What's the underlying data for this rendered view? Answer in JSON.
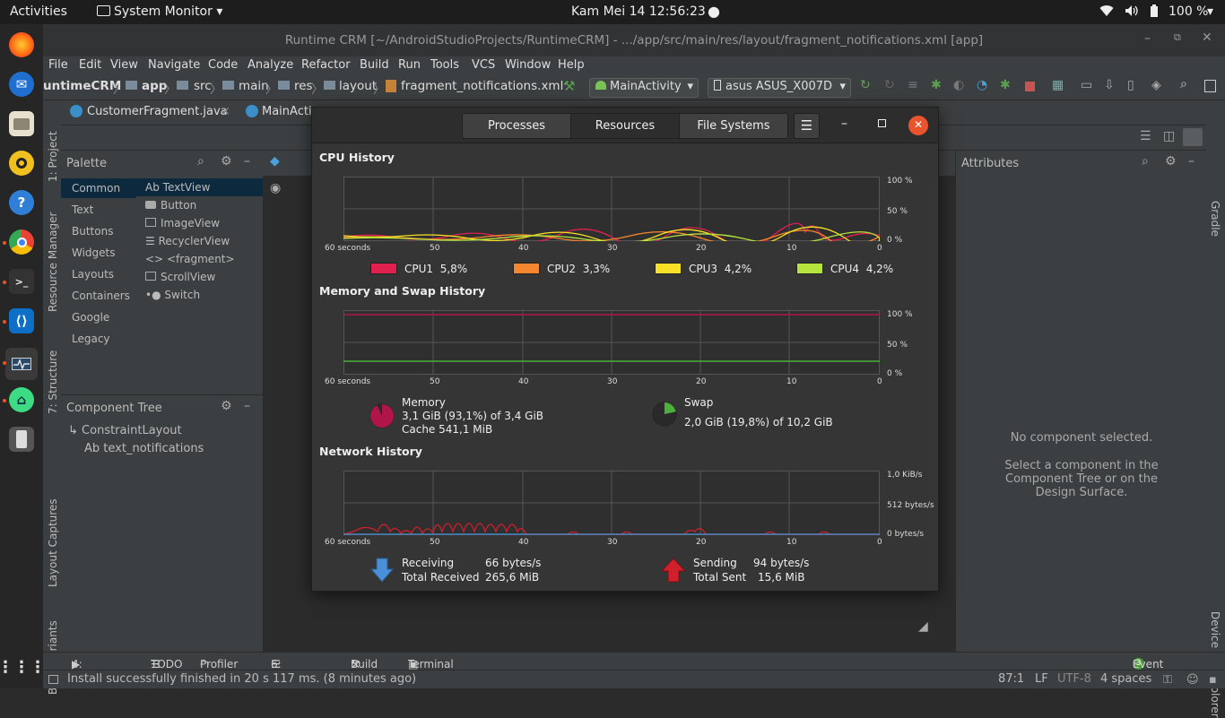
{
  "topbar": {
    "activities": "Activities",
    "app_menu": "System Monitor",
    "clock": "Kam Mei 14  12:56:23",
    "battery": "100 %"
  },
  "ide": {
    "title": "Runtime CRM [~/AndroidStudioProjects/RuntimeCRM] - .../app/src/main/res/layout/fragment_notifications.xml [app]",
    "menu": [
      "File",
      "Edit",
      "View",
      "Navigate",
      "Code",
      "Analyze",
      "Refactor",
      "Build",
      "Run",
      "Tools",
      "VCS",
      "Window",
      "Help"
    ],
    "breadcrumb": [
      "untimeCRM",
      "app",
      "src",
      "main",
      "res",
      "layout",
      "fragment_notifications.xml"
    ],
    "run_config": "MainActivity",
    "device": "asus ASUS_X007D",
    "tabs": [
      "CustomerFragment.java",
      "MainActiv"
    ],
    "left_strip": [
      "1: Project",
      "Resource Manager",
      "7: Structure",
      "Layout Captures",
      "Build Variants"
    ],
    "right_strip": [
      "Gradle",
      "Device File Explorer"
    ],
    "palette": {
      "title": "Palette",
      "categories": [
        "Common",
        "Text",
        "Buttons",
        "Widgets",
        "Layouts",
        "Containers",
        "Google",
        "Legacy"
      ],
      "items": [
        "TextView",
        "Button",
        "ImageView",
        "RecyclerView",
        "<fragment>",
        "ScrollView",
        "Switch"
      ],
      "textview_prefix": "Ab"
    },
    "component_tree": {
      "title": "Component Tree",
      "root": "ConstraintLayout",
      "child_prefix": "Ab",
      "child": "text_notifications"
    },
    "attributes": {
      "title": "Attributes",
      "empty_title": "No component selected.",
      "empty_hint": "Select a component in the Component Tree or on the Design Surface."
    },
    "bottom_tools": {
      "run": "4: Run",
      "todo": "TODO",
      "profiler": "Profiler",
      "logcat": "6: Logcat",
      "build": "Build",
      "terminal": "Terminal",
      "event_log_count": "3",
      "event_log": "Event Log"
    },
    "status": {
      "message": "Install successfully finished in 20 s 117 ms. (8 minutes ago)",
      "position": "87:1",
      "line_sep": "LF",
      "encoding": "UTF-8",
      "indent": "4 spaces"
    }
  },
  "sysmon": {
    "tabs": [
      "Processes",
      "Resources",
      "File Systems"
    ],
    "active_tab": "Resources",
    "x_ticks": [
      "60 seconds",
      "50",
      "40",
      "30",
      "20",
      "10",
      "0"
    ],
    "cpu": {
      "title": "CPU History",
      "y_ticks": [
        "100 %",
        "50 %",
        "0 %"
      ],
      "legend": [
        {
          "name": "CPU1",
          "value": "5,8%",
          "color": "#e0204f"
        },
        {
          "name": "CPU2",
          "value": "3,3%",
          "color": "#f5862f"
        },
        {
          "name": "CPU3",
          "value": "4,2%",
          "color": "#f7e126"
        },
        {
          "name": "CPU4",
          "value": "4,2%",
          "color": "#b6e43c"
        }
      ]
    },
    "memory": {
      "title": "Memory and Swap History",
      "y_ticks": [
        "100 %",
        "50 %",
        "0 %"
      ],
      "mem_label": "Memory",
      "mem_used": "3,1 GiB (93,1%) of 3,4 GiB",
      "mem_cache": "Cache 541,1 MiB",
      "mem_color": "#b0154a",
      "swap_label": "Swap",
      "swap_used": "2,0 GiB (19,8%) of 10,2 GiB",
      "swap_color": "#4ab03a"
    },
    "network": {
      "title": "Network History",
      "y_ticks": [
        "1,0 KiB/s",
        "512 bytes/s",
        "0 bytes/s"
      ],
      "receiving_label": "Receiving",
      "receiving_value": "66 bytes/s",
      "total_received_label": "Total Received",
      "total_received_value": "265,6 MiB",
      "sending_label": "Sending",
      "sending_value": "94 bytes/s",
      "total_sent_label": "Total Sent",
      "total_sent_value": "15,6 MiB",
      "recv_color": "#4a90d9",
      "send_color": "#d0202a"
    }
  }
}
